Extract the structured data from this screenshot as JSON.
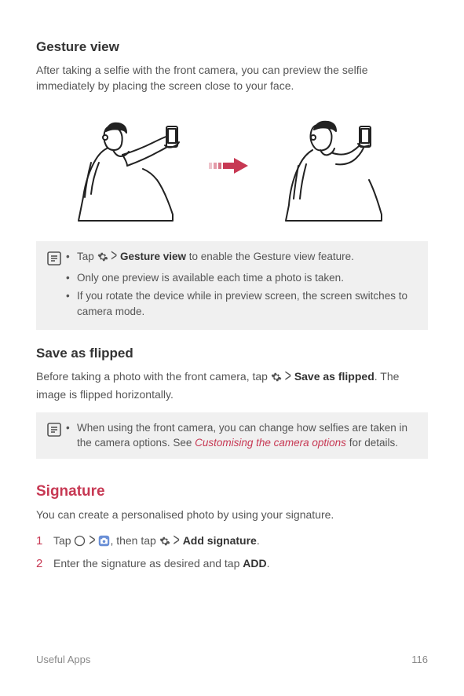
{
  "section1": {
    "heading": "Gesture view",
    "intro": "After taking a selfie with the front camera, you can preview the selfie immediately by placing the screen close to your face."
  },
  "note1": {
    "item1_pre": "Tap ",
    "item1_bold": "Gesture view",
    "item1_post": " to enable the Gesture view feature.",
    "item2": "Only one preview is available each time a photo is taken.",
    "item3": "If you rotate the device while in preview screen, the screen switches to camera mode."
  },
  "section2": {
    "heading": "Save as flipped",
    "intro_pre": "Before taking a photo with the front camera, tap ",
    "intro_bold": "Save as flipped",
    "intro_post": ". The image is flipped horizontally."
  },
  "note2": {
    "text_pre": "When using the front camera, you can change how selfies are taken in the camera options. See ",
    "link": "Customising the camera options",
    "text_post": " for details."
  },
  "section3": {
    "heading": "Signature",
    "intro": "You can create a personalised photo by using your signature.",
    "step1_pre": "Tap ",
    "step1_mid": ", then tap ",
    "step1_bold": "Add signature",
    "step1_post": ".",
    "step2_pre": "Enter the signature as desired and tap ",
    "step2_bold": "ADD",
    "step2_post": "."
  },
  "footer": {
    "left": "Useful Apps",
    "right": "116"
  }
}
